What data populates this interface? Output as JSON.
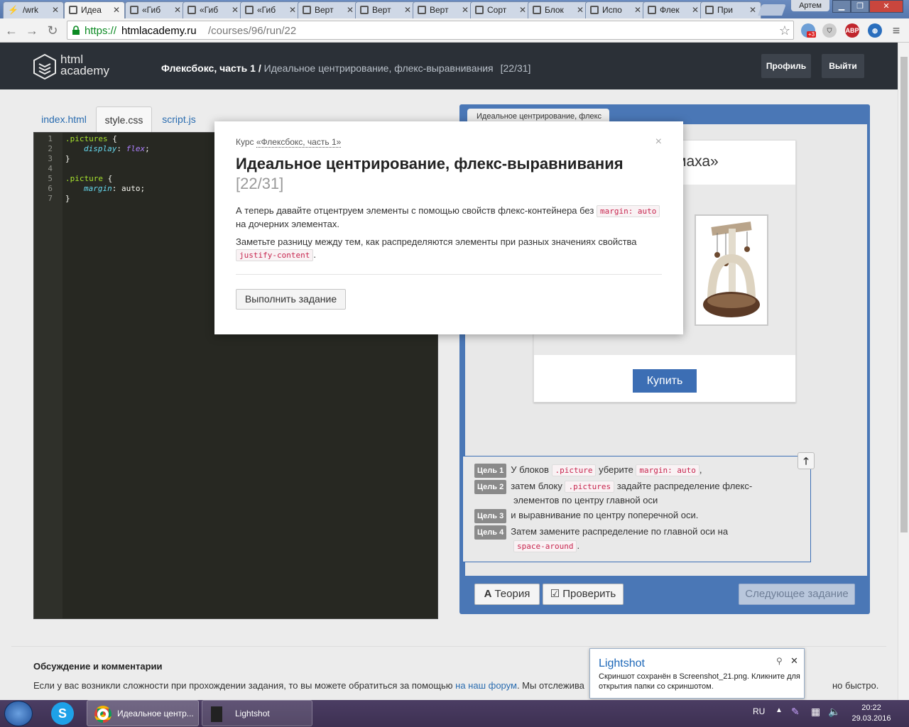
{
  "browser": {
    "tabs": [
      {
        "label": "/wrk",
        "icon": "bolt-icon"
      },
      {
        "label": "Идеа",
        "icon": "htmlacademy-icon"
      },
      {
        "label": "«Гиб",
        "icon": "htmlacademy-icon"
      },
      {
        "label": "«Гиб",
        "icon": "htmlacademy-icon"
      },
      {
        "label": "«Гиб",
        "icon": "htmlacademy-icon"
      },
      {
        "label": "Верт",
        "icon": "htmlacademy-icon"
      },
      {
        "label": "Верт",
        "icon": "htmlacademy-icon"
      },
      {
        "label": "Верт",
        "icon": "htmlacademy-icon"
      },
      {
        "label": "Сорт",
        "icon": "htmlacademy-icon"
      },
      {
        "label": "Блок",
        "icon": "htmlacademy-icon"
      },
      {
        "label": "Испо",
        "icon": "htmlacademy-icon"
      },
      {
        "label": "Флек",
        "icon": "htmlacademy-icon"
      },
      {
        "label": "При",
        "icon": "htmlacademy-icon"
      }
    ],
    "user": "Артем",
    "url_scheme": "https://",
    "url_host": "htmlacademy.ru",
    "url_path": "/courses/96/run/22",
    "ext_badge": "+3",
    "abp": "ABP"
  },
  "header": {
    "logo_line1": "html",
    "logo_line2": "academy",
    "course": "Флексбокс, часть 1",
    "separator": " / ",
    "lesson": "Идеальное центрирование, флекс-выравнивания",
    "progress": "[22/31]",
    "profile": "Профиль",
    "logout": "Выйти"
  },
  "editor": {
    "tabs": [
      "index.html",
      "style.css",
      "script.js"
    ],
    "active_tab": "style.css",
    "lines": [
      "1",
      "2",
      "3",
      "4",
      "5",
      "6",
      "7"
    ],
    "code": {
      "sel1": ".pictures",
      "brace_open": " {",
      "prop1": "display",
      "val1": "flex",
      "brace_close": "}",
      "sel2": ".picture",
      "prop2": "margin",
      "val2": "auto"
    }
  },
  "preview": {
    "tab": "Идеальное центрирование, флекс",
    "card_title": "маха»",
    "buy": "Купить"
  },
  "goals": [
    {
      "label": "Цель 1",
      "t1": "У блоков ",
      "c1": ".picture",
      "t2": " уберите ",
      "c2": "margin: auto",
      "t3": ","
    },
    {
      "label": "Цель 2",
      "t1": "затем блоку ",
      "c1": ".pictures",
      "t2": " задайте распределение флекс-элементов по центру главной оси"
    },
    {
      "label": "Цель 3",
      "t1": "и выравнивание по центру поперечной оси."
    },
    {
      "label": "Цель 4",
      "t1": "Затем замените распределение по главной оси на ",
      "c1": "space-around",
      "t2": "."
    }
  ],
  "actions": {
    "theory": "Теория",
    "check": "Проверить",
    "next": "Следующее задание"
  },
  "modal": {
    "course_prefix": "Курс ",
    "course_link": "«Флексбокс, часть 1»",
    "close": "×",
    "title": "Идеальное центрирование, флекс-выравнивания",
    "num": "[22/31]",
    "p1_a": "А теперь давайте отцентруем элементы с помощью свойств флекс-контейнера без ",
    "p1_code": "margin: auto",
    "p1_b": " на дочерних элементах.",
    "p2_a": "Заметьте разницу между тем, как распределяются элементы при разных значениях свойства ",
    "p2_code": "justify-content",
    "p2_b": ".",
    "button": "Выполнить задание"
  },
  "discussion": {
    "title": "Обсуждение и комментарии",
    "text_a": "Если у вас возникли сложности при прохождении задания, то вы можете обратиться за помощью ",
    "link": "на наш форум",
    "text_b": ". Мы отслежива",
    "tail": "но быстро."
  },
  "lightshot": {
    "title": "Lightshot",
    "body": "Скриншот сохранён в Screenshot_21.png. Кликните для открытия папки со скриншотом."
  },
  "taskbar": {
    "chrome_item": "Идеальное центр...",
    "lightshot_item": "Lightshot",
    "lang": "RU",
    "time": "20:22",
    "date": "29.03.2016"
  }
}
